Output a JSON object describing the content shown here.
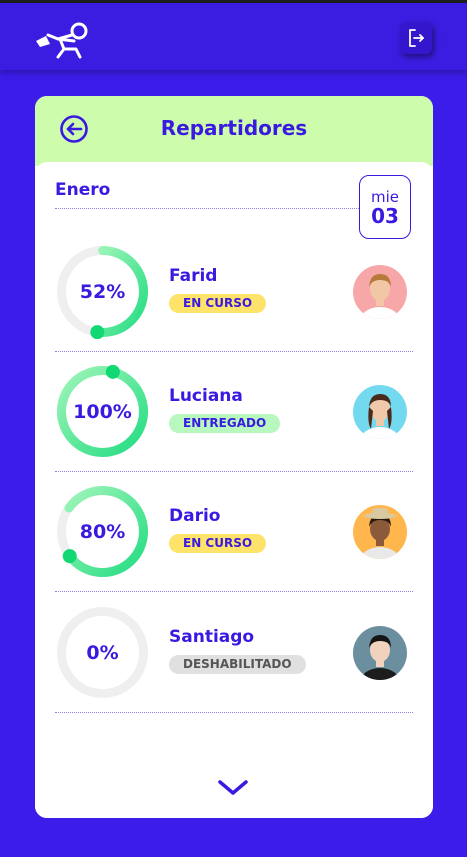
{
  "header": {
    "title": "Repartidores",
    "month": "Enero"
  },
  "date_badge": {
    "day_name": "mie",
    "day_number": "03"
  },
  "colors": {
    "accent": "#3a1ae0",
    "header_bg": "#ccfcac",
    "progress": "#23dc82"
  },
  "icons": {
    "logo": "runner-logo-icon",
    "logout": "logout-icon",
    "back": "back-arrow-icon",
    "expand": "chevron-down-icon"
  },
  "deliverers": [
    {
      "name": "Farid",
      "progress": 52,
      "progress_label": "52%",
      "status": "EN CURSO",
      "avatar_bg": "#f7a7a7"
    },
    {
      "name": "Luciana",
      "progress": 100,
      "progress_label": "100%",
      "status": "ENTREGADO",
      "avatar_bg": "#73d9ee"
    },
    {
      "name": "Dario",
      "progress": 80,
      "progress_label": "80%",
      "status": "EN CURSO",
      "avatar_bg": "#ffb64d"
    },
    {
      "name": "Santiago",
      "progress": 0,
      "progress_label": "0%",
      "status": "DESHABILITADO",
      "avatar_bg": "#6c8fa0"
    }
  ]
}
